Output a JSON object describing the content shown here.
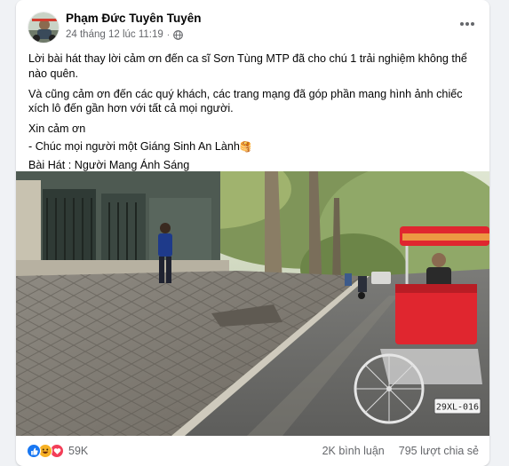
{
  "post": {
    "author": "Phạm Đức Tuyên Tuyên",
    "timestamp": "24 tháng 12 lúc 11:19",
    "separator": "·",
    "privacy_icon": "globe-icon",
    "more_icon": "more-horizontal-icon",
    "text_lines": [
      "Lời bài hát thay lời cảm ơn đến ca sĩ Sơn Tùng MTP đã cho chú 1 trải nghiệm không thể nào quên.",
      "Và cũng cảm ơn đến các quý khách, các trang mạng đã góp phần mang hình ảnh chiếc xích lô đến gần hơn với tất cả mọi người.",
      "Xin cảm ơn",
      "- Chúc mọi người một Giáng Sinh An Lành",
      "Bài Hát : Người Mang Ánh Sáng"
    ],
    "greeting_emoji": "🥞",
    "media": {
      "type": "video",
      "license_plate": "29XL-016"
    }
  },
  "footer": {
    "reaction_icons": [
      "like-icon",
      "haha-icon",
      "love-icon"
    ],
    "reaction_count": "59K",
    "comments": "2K bình luận",
    "shares": "795 lượt chia sẻ"
  },
  "colors": {
    "text_primary": "#050505",
    "text_secondary": "#65676b",
    "like_blue": "#1877f2",
    "love_red": "#f33e58",
    "haha_yellow": "#f7b125",
    "rickshaw_red": "#e0262f"
  }
}
